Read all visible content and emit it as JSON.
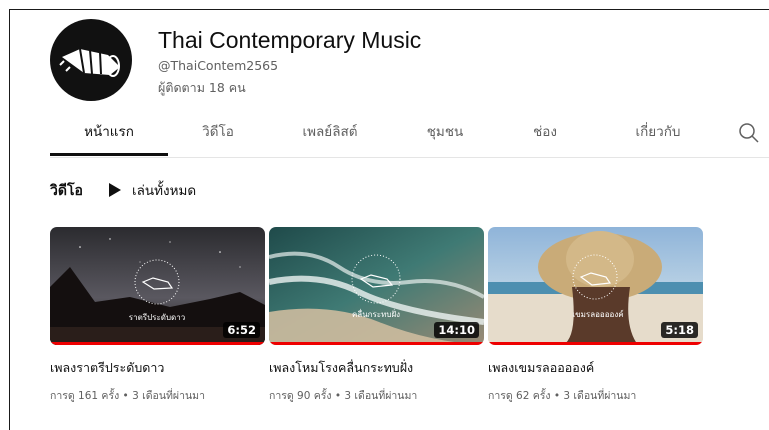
{
  "channel": {
    "name": "Thai Contemporary Music",
    "handle": "@ThaiContem2565",
    "subscribers": "ผู้ติดตาม 18 คน",
    "avatar_icon": "boat-logo-icon"
  },
  "tabs": [
    {
      "label": "หน้าแรก",
      "active": true
    },
    {
      "label": "วิดีโอ"
    },
    {
      "label": "เพลย์ลิสต์"
    },
    {
      "label": "ชุมชน"
    },
    {
      "label": "ช่อง"
    },
    {
      "label": "เกี่ยวกับ"
    }
  ],
  "search_icon": "search-icon",
  "section": {
    "title": "วิดีโอ",
    "play_all": "เล่นทั้งหมด"
  },
  "videos": [
    {
      "title": "เพลงราตรีประดับดาว",
      "duration": "6:52",
      "meta": "การดู 161 ครั้ง • 3 เดือนที่ผ่านมา",
      "overlay_text": "ราตรีประดับดาว"
    },
    {
      "title": "เพลงโหมโรงคลื่นกระทบฝั่ง",
      "duration": "14:10",
      "meta": "การดู 90 ครั้ง • 3 เดือนที่ผ่านมา",
      "overlay_text": "คลื่นกระทบฝั่ง"
    },
    {
      "title": "เพลงเขมรลอออองค์",
      "duration": "5:18",
      "meta": "การดู 62 ครั้ง • 3 เดือนที่ผ่านมา",
      "overlay_text": "เขมรลอออองค์"
    }
  ],
  "colors": {
    "progress_red": "#e00000",
    "text_secondary": "#606060"
  }
}
